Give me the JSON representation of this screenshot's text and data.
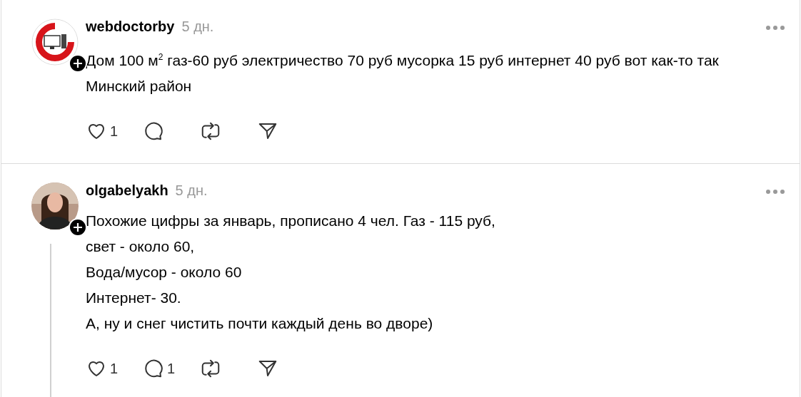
{
  "comments": [
    {
      "username": "webdoctorby",
      "time": "5 дн.",
      "avatar": {
        "kind": "logo"
      },
      "lines": [
        "Дом 100 м$^{2}$ газ-60 руб электричество 70 руб мусорка 15 руб интернет 40 руб вот как-то так Минский район"
      ],
      "likes": "1",
      "thread": false
    },
    {
      "username": "olgabelyakh",
      "time": "5 дн.",
      "lines": [
        "Похожие цифры за январь, прописано 4 чел. Газ - 115 руб,",
        "свет - около 60,",
        "Вода/мусор - около 60",
        "Интернет- 30.",
        "А, ну и снег чистить почти каждый день во дворе)"
      ],
      "likes": "1",
      "replies": "1",
      "thread": true
    }
  ]
}
